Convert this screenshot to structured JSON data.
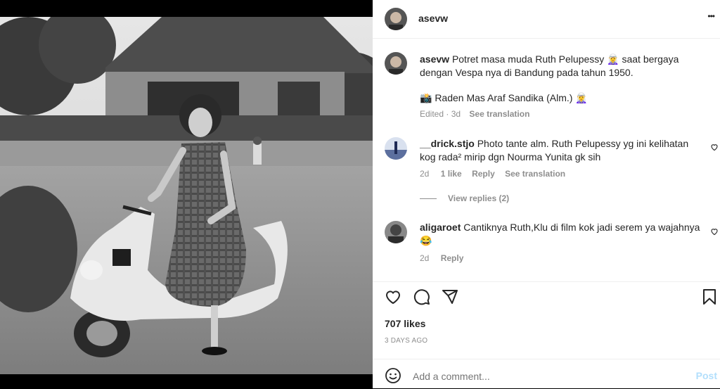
{
  "post": {
    "author": "asevw",
    "more_label": "•••"
  },
  "caption": {
    "author": "asevw",
    "line1": "Potret masa muda Ruth Pelupessy 🧝‍♀️  saat bergaya",
    "line2": "dengan Vespa nya di Bandung pada tahun 1950.",
    "credit": "📸 Raden Mas Araf Sandika (Alm.) 🧝‍♀️",
    "time": "Edited · 3d",
    "see_translation": "See translation"
  },
  "comments": [
    {
      "author": "__drick.stjo",
      "line1": "Photo tante alm. Ruth Pelupessy yg ini kelihatan",
      "line2": "kog rada² mirip dgn Nourma Yunita gk sih",
      "time": "2d",
      "likes": "1 like",
      "reply": "Reply",
      "see_translation": "See translation",
      "view_replies": "View replies (2)"
    },
    {
      "author": "aligaroet",
      "line1": "Cantiknya Ruth,Klu di film kok jadi serem ya wajahnya",
      "line2": "😂",
      "time": "2d",
      "reply": "Reply"
    }
  ],
  "stats": {
    "likes": "707 likes",
    "date": "3 DAYS AGO"
  },
  "comment_box": {
    "placeholder": "Add a comment...",
    "post_label": "Post"
  },
  "colors": {
    "link": "#0095f6",
    "muted": "#8e8e8e",
    "text": "#262626"
  }
}
